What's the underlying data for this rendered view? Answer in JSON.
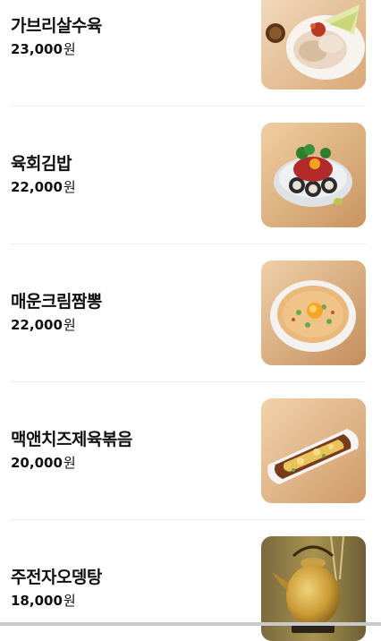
{
  "menu": {
    "currency_unit": "원",
    "items": [
      {
        "name": "가브리살수육",
        "price": "23,000",
        "image_icon": "boiled-pork-photo"
      },
      {
        "name": "육회김밥",
        "price": "22,000",
        "image_icon": "yukhoe-kimbap-photo"
      },
      {
        "name": "매운크림짬뽕",
        "price": "22,000",
        "image_icon": "spicy-cream-jjamppong-photo"
      },
      {
        "name": "맥앤치즈제육볶음",
        "price": "20,000",
        "image_icon": "mac-cheese-jeyuk-photo"
      },
      {
        "name": "주전자오뎅탕",
        "price": "18,000",
        "image_icon": "kettle-odeng-soup-photo"
      }
    ]
  },
  "colors": {
    "text": "#111111",
    "divider": "#efefef",
    "photo_wood": "#e9c79c"
  }
}
